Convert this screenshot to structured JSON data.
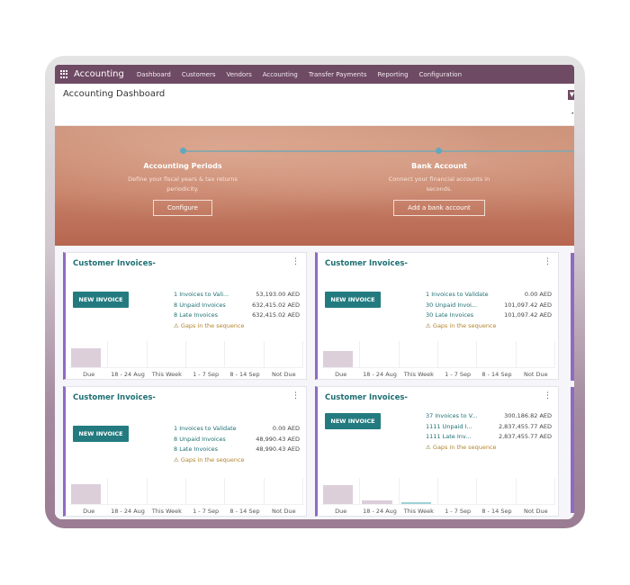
{
  "navbar": {
    "app_name": "Accounting",
    "items": [
      "Dashboard",
      "Customers",
      "Vendors",
      "Accounting",
      "Transfer Payments",
      "Reporting",
      "Configuration"
    ]
  },
  "control_panel": {
    "title": "Accounting Dashboard",
    "filter_icon": "filter-icon"
  },
  "banner": {
    "steps": [
      {
        "title": "Accounting Periods",
        "desc_line1": "Define your fiscal years & tax returns",
        "desc_line2": "periodicity.",
        "button": "Configure"
      },
      {
        "title": "Bank Account",
        "desc_line1": "Connect your financial accounts in",
        "desc_line2": "seconds.",
        "button": "Add a bank account"
      }
    ]
  },
  "chart_ticks": [
    "Due",
    "18 - 24 Aug",
    "This Week",
    "1 - 7 Sep",
    "8 - 14 Sep",
    "Not Due"
  ],
  "cards": [
    {
      "title": "Customer Invoices-",
      "new_invoice": "NEW INVOICE",
      "stats": [
        {
          "label": "1 Invoices to Vali...",
          "value": "53,193.00 AED"
        },
        {
          "label": "8 Unpaid Invoices",
          "value": "632,415.02 AED"
        },
        {
          "label": "8 Late Invoices",
          "value": "632,415.02 AED"
        }
      ],
      "warning": "Gaps in the sequence",
      "bars": [
        0.8,
        0,
        0,
        0,
        0,
        0
      ]
    },
    {
      "title": "Customer Invoices-",
      "new_invoice": "NEW INVOICE",
      "stats": [
        {
          "label": "1 Invoices to Validate",
          "value": "0.00 AED"
        },
        {
          "label": "30 Unpaid Invoi...",
          "value": "101,097.42 AED"
        },
        {
          "label": "30 Late Invoices",
          "value": "101,097.42 AED"
        }
      ],
      "warning": "Gaps in the sequence",
      "bars": [
        0.7,
        0,
        0,
        0,
        0,
        0
      ]
    },
    {
      "title": "Customer Invoices-",
      "new_invoice": "NEW INVOICE",
      "stats": [
        {
          "label": "1 Invoices to Validate",
          "value": "0.00 AED"
        },
        {
          "label": "8 Unpaid Invoices",
          "value": "48,990.43 AED"
        },
        {
          "label": "8 Late Invoices",
          "value": "48,990.43 AED"
        }
      ],
      "warning": "Gaps in the sequence",
      "bars": [
        0.85,
        0,
        0,
        0,
        0,
        0
      ]
    },
    {
      "title": "Customer Invoices-",
      "new_invoice": "NEW INVOICE",
      "stats": [
        {
          "label": "37 Invoices to V...",
          "value": "300,186.82 AED"
        },
        {
          "label": "1111 Unpaid I...",
          "value": "2,837,455.77 AED"
        },
        {
          "label": "1111 Late Inv...",
          "value": "2,837,455.77 AED"
        }
      ],
      "warning": "Gaps in the sequence",
      "bars": [
        0.8,
        0.15,
        0.05,
        0,
        0,
        0
      ]
    }
  ],
  "colors": {
    "brand": "#6f4a64",
    "teal": "#237b80",
    "card_accent": "#8e6bc2",
    "warning": "#b3842a"
  }
}
